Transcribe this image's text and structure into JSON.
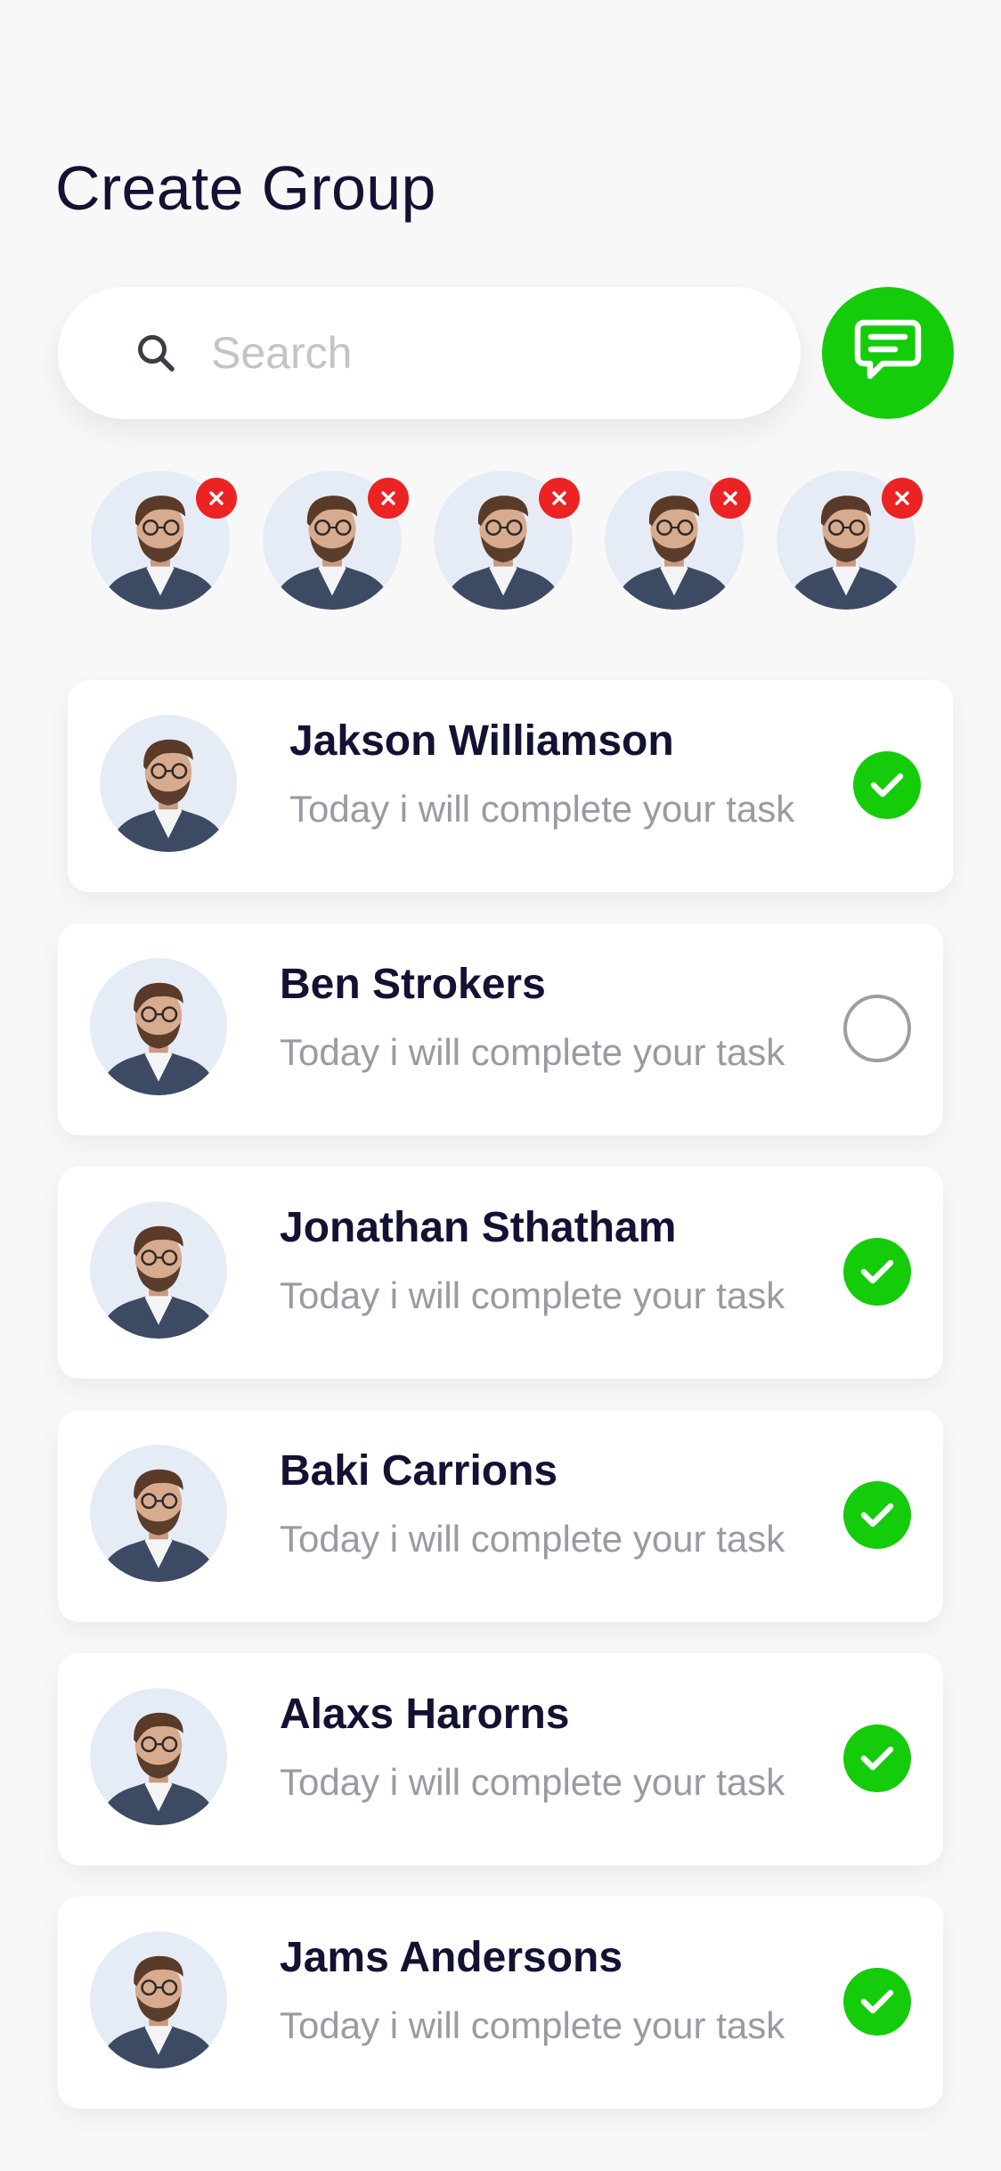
{
  "header": {
    "title": "Create Group"
  },
  "search": {
    "placeholder": "Search",
    "value": ""
  },
  "icons": {
    "search": "search-icon",
    "message": "message-icon",
    "remove": "close-icon",
    "check": "check-icon"
  },
  "colors": {
    "accent": "#14CC0A",
    "remove": "#EC2323",
    "title": "#141233",
    "subtitle": "#9A9AA2",
    "background": "#F8F8F9"
  },
  "selected_members": [
    {
      "removable": true
    },
    {
      "removable": true
    },
    {
      "removable": true
    },
    {
      "removable": true
    },
    {
      "removable": true
    }
  ],
  "contacts": [
    {
      "name": "Jakson Williamson",
      "status": "Today i will complete your task",
      "selected": true
    },
    {
      "name": "Ben Strokers",
      "status": "Today i will complete your task",
      "selected": false
    },
    {
      "name": "Jonathan Sthatham",
      "status": "Today i will complete your task",
      "selected": true
    },
    {
      "name": "Baki Carrions",
      "status": "Today i will complete your task",
      "selected": true
    },
    {
      "name": "Alaxs Harorns",
      "status": "Today i will complete your task",
      "selected": true
    },
    {
      "name": "Jams Andersons",
      "status": "Today i will complete your task",
      "selected": true
    }
  ]
}
